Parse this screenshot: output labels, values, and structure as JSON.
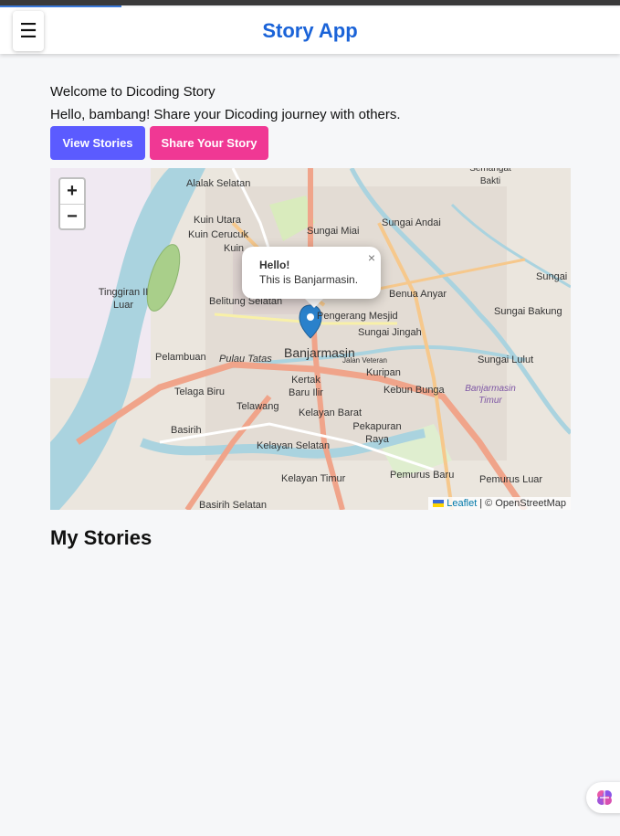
{
  "app": {
    "title": "Story App"
  },
  "header": {
    "menu_icon": "hamburger-icon"
  },
  "home": {
    "welcome": "Welcome to Dicoding Story",
    "greeting": "Hello, bambang! Share your Dicoding journey with others.",
    "view_stories_label": "View Stories",
    "share_story_label": "Share Your Story",
    "my_stories_title": "My Stories"
  },
  "map": {
    "zoom_in": "+",
    "zoom_out": "−",
    "popup_title": "Hello!",
    "popup_body": "This is Banjarmasin.",
    "popup_close": "×",
    "attribution_leaflet": "Leaflet",
    "attribution_osm": "| © OpenStreetMap",
    "labels": {
      "alalak_selatan": "Alalak Selatan",
      "semangat_bakti": "Semangat Bakti",
      "kuin_utara": "Kuin Utara",
      "kuin_cerucuk": "Kuin Cerucuk",
      "kuin": "Kuin",
      "sungai_miai": "Sungai Miai",
      "sungai_andai": "Sungai Andai",
      "tinggiran": "Tinggiran II Luar",
      "belitung_selatan": "Belitung Selatan",
      "benua_anyar": "Benua Anyar",
      "sungai_bakung": "Sungai Bakung",
      "sungai": "Sungai",
      "pasar_lama": "Pengerang Mesjid",
      "sungai_jingah": "Sungai Jingah",
      "pelambuan": "Pelambuan",
      "pulau_tatas": "Pulau Tatas",
      "banjarmasin": "Banjarmasin",
      "sungai_lulut": "Sungai Lulut",
      "kuripan": "Kuripan",
      "telaga_biru": "Telaga Biru",
      "kertak_baru": "Kertak Baru Ilir",
      "kebun_bunga": "Kebun Bunga",
      "banjarmasin_timur": "Banjarmasin Timur",
      "telawang": "Telawang",
      "kelayan_barat": "Kelayan Barat",
      "basirih": "Basirih",
      "pekapuran_raya": "Pekapuran Raya",
      "kelayan_selatan": "Kelayan Selatan",
      "kelayan_timur": "Kelayan Timur",
      "pemurus_baru": "Pemurus Baru",
      "pemurus_luar": "Pemurus Luar",
      "basirih_selatan": "Basirih Selatan",
      "jalan_veteran": "Jalan Veteran"
    }
  },
  "fab": {
    "icon": "brain-icon"
  }
}
